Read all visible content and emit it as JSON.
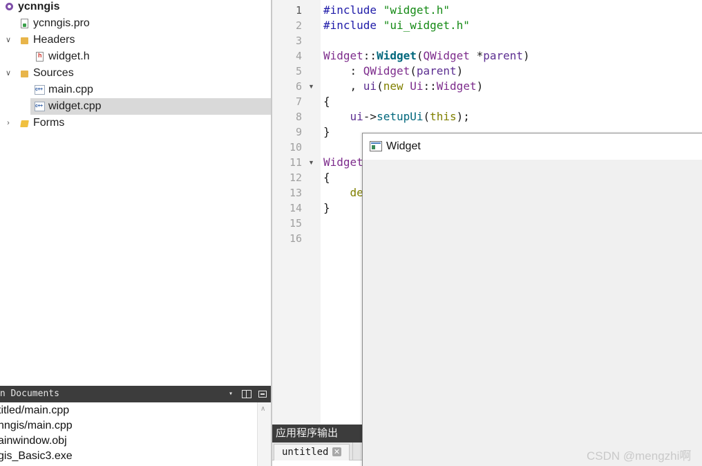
{
  "project_tree": {
    "root": "ycnngis",
    "items": [
      {
        "label": "ycnngis.pro",
        "icon": "pro-file-icon"
      },
      {
        "label": "Headers",
        "icon": "folder-icon",
        "expanded": true
      },
      {
        "label": "widget.h",
        "icon": "header-file-icon"
      },
      {
        "label": "Sources",
        "icon": "folder-icon",
        "expanded": true
      },
      {
        "label": "main.cpp",
        "icon": "cpp-file-icon"
      },
      {
        "label": "widget.cpp",
        "icon": "cpp-file-icon",
        "selected": true
      },
      {
        "label": "Forms",
        "icon": "forms-folder-icon",
        "expanded": false
      }
    ]
  },
  "open_documents": {
    "title": "en Documents",
    "items": [
      "titled/main.cpp",
      "nngis/main.cpp",
      "ainwindow.obj",
      "gis_Basic3.exe"
    ]
  },
  "editor": {
    "line_numbers": [
      "1",
      "2",
      "3",
      "4",
      "5",
      "6",
      "7",
      "8",
      "9",
      "10",
      "11",
      "12",
      "13",
      "14",
      "15",
      "16"
    ],
    "current_line": 1
  },
  "app_output": {
    "title": "应用程序输出",
    "tab_label": "untitled"
  },
  "widget_window": {
    "title": "Widget"
  },
  "watermark": "CSDN @mengzhi啊"
}
